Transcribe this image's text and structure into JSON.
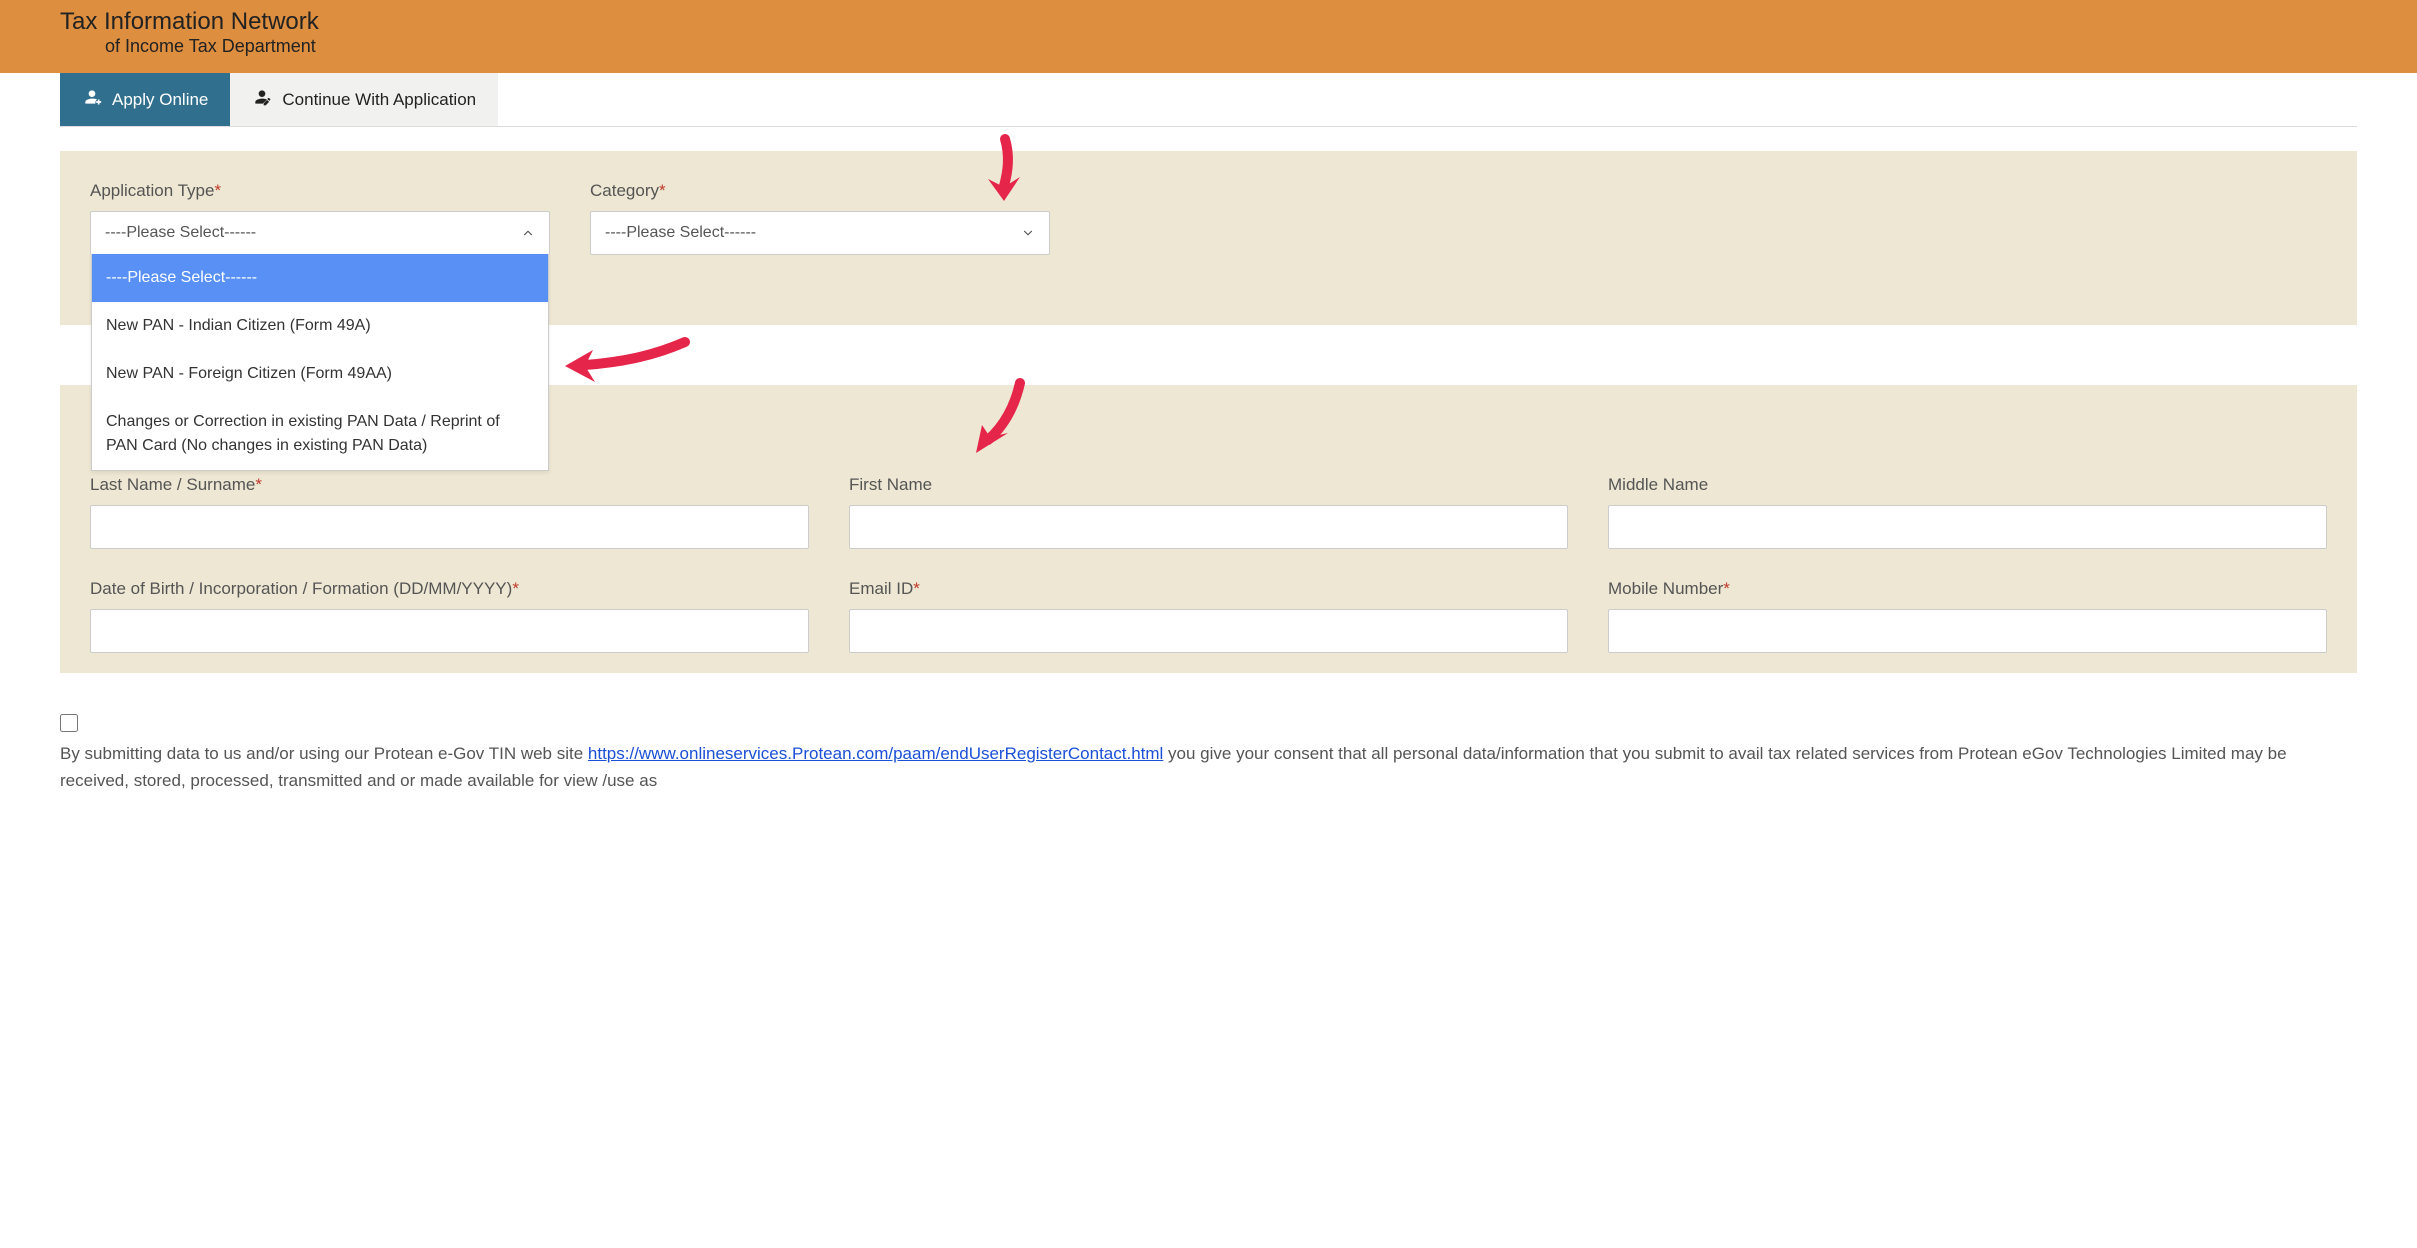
{
  "header": {
    "title": "Tax Information Network",
    "subtitle": "of Income Tax Department"
  },
  "tabs": {
    "apply": "Apply Online",
    "continue": "Continue With Application"
  },
  "app_type": {
    "label": "Application Type",
    "selected": "----Please Select------",
    "options": [
      "----Please Select------",
      "New PAN - Indian Citizen (Form 49A)",
      "New PAN - Foreign Citizen (Form 49AA)",
      "Changes or Correction in existing PAN Data / Reprint of PAN Card (No changes in existing PAN Data)"
    ]
  },
  "category": {
    "label": "Category",
    "selected": "----Please Select------"
  },
  "fields": {
    "last_name": "Last Name / Surname",
    "first_name": "First Name",
    "middle_name": "Middle Name",
    "dob": "Date of Birth / Incorporation / Formation (DD/MM/YYYY)",
    "email": "Email ID",
    "mobile": "Mobile Number"
  },
  "consent": {
    "text_before": "By submitting data to us and/or using our Protean e-Gov TIN web site ",
    "link_text": "https://www.onlineservices.Protean.com/paam/endUserRegisterContact.html",
    "text_after": " you give your consent that all personal data/information that you submit to avail tax related services from Protean eGov Technologies Limited may be received, stored, processed, transmitted and or made available for view /use as"
  }
}
